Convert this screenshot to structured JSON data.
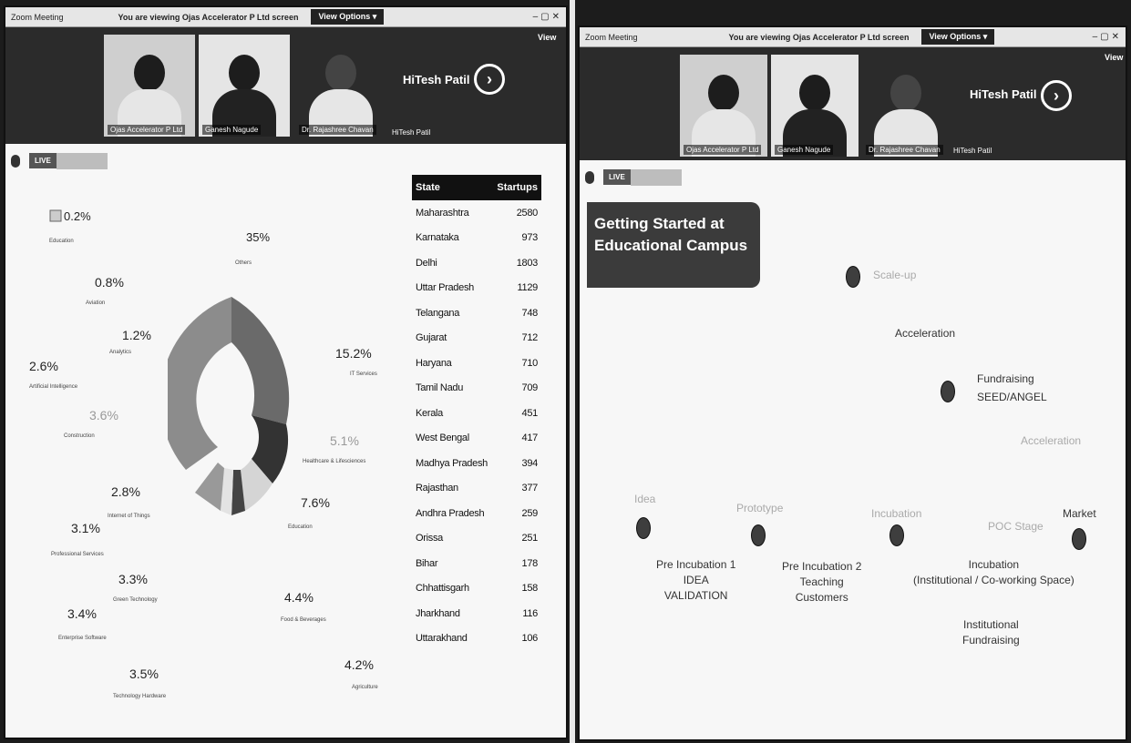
{
  "left_window": {
    "titlebar": {
      "title": "Zoom Meeting",
      "viewing": "You are viewing Ojas Accelerator P Ltd screen",
      "view_options": "View Options ▾"
    },
    "view_button": "View",
    "participants": [
      {
        "name": "Ojas Accelerator P Ltd"
      },
      {
        "name": "Ganesh Nagude"
      },
      {
        "name": "Dr. Rajashree Chavan"
      },
      {
        "name": "HiTesh Patil"
      }
    ],
    "featured_name": "HiTesh Patil",
    "next_icon": "chevron-right-circle-icon",
    "live_label": "LIVE",
    "chart": {
      "labels": [
        {
          "pct": "0.2%",
          "sector": "Education"
        },
        {
          "pct": "35%",
          "sector": "Others"
        },
        {
          "pct": "0.8%",
          "sector": "Aviation"
        },
        {
          "pct": "1.2%",
          "sector": "Analytics"
        },
        {
          "pct": "2.6%",
          "sector": "Artificial Intelligence"
        },
        {
          "pct": "3.6%",
          "sector": "Construction"
        },
        {
          "pct": "2.8%",
          "sector": "Internet of Things"
        },
        {
          "pct": "3.1%",
          "sector": "Professional Services"
        },
        {
          "pct": "3.3%",
          "sector": "Green Technology"
        },
        {
          "pct": "3.4%",
          "sector": "Enterprise Software"
        },
        {
          "pct": "3.5%",
          "sector": "Technology Hardware"
        },
        {
          "pct": "15.2%",
          "sector": "IT Services"
        },
        {
          "pct": "5.1%",
          "sector": "Healthcare & Lifesciences"
        },
        {
          "pct": "7.6%",
          "sector": "Education"
        },
        {
          "pct": "4.4%",
          "sector": "Food & Beverages"
        },
        {
          "pct": "4.2%",
          "sector": "Agriculture"
        }
      ]
    },
    "table": {
      "headers": [
        "State",
        "Startups"
      ],
      "rows": [
        [
          "Maharashtra",
          "2580"
        ],
        [
          "Karnataka",
          "973"
        ],
        [
          "Delhi",
          "1803"
        ],
        [
          "Uttar Pradesh",
          "1129"
        ],
        [
          "Telangana",
          "748"
        ],
        [
          "Gujarat",
          "712"
        ],
        [
          "Haryana",
          "710"
        ],
        [
          "Tamil Nadu",
          "709"
        ],
        [
          "Kerala",
          "451"
        ],
        [
          "West Bengal",
          "417"
        ],
        [
          "Madhya Pradesh",
          "394"
        ],
        [
          "Rajasthan",
          "377"
        ],
        [
          "Andhra Pradesh",
          "259"
        ],
        [
          "Orissa",
          "251"
        ],
        [
          "Bihar",
          "178"
        ],
        [
          "Chhattisgarh",
          "158"
        ],
        [
          "Jharkhand",
          "116"
        ],
        [
          "Uttarakhand",
          "106"
        ]
      ]
    }
  },
  "right_window": {
    "titlebar": {
      "title": "Zoom Meeting",
      "viewing": "You are viewing Ojas Accelerator P Ltd screen",
      "view_options": "View Options ▾"
    },
    "view_button": "View",
    "participants": [
      {
        "name": "Ojas Accelerator P Ltd"
      },
      {
        "name": "Ganesh Nagude"
      },
      {
        "name": "Dr. Rajashree Chavan"
      },
      {
        "name": "HiTesh Patil"
      }
    ],
    "featured_name": "HiTesh Patil",
    "live_label": "LIVE",
    "slide": {
      "title_line1": "Getting Started at",
      "title_line2": "Educational Campus",
      "top_labels": {
        "scale_up": "Scale-up",
        "acceleration_1": "Acceleration",
        "fundraising_line1": "Fundraising",
        "fundraising_line2": "SEED/ANGEL",
        "acceleration_2": "Acceleration"
      },
      "stages": [
        {
          "top": "Idea",
          "bottom_lines": [
            "Pre Incubation 1",
            "IDEA",
            "VALIDATION"
          ]
        },
        {
          "top": "Prototype",
          "bottom_lines": [
            "Pre Incubation 2",
            "Teaching",
            "Customers"
          ]
        },
        {
          "top": "Incubation",
          "bottom_lines": [
            "Incubation",
            "(Institutional / Co-working Space)"
          ]
        },
        {
          "top": "POC Stage",
          "bottom_lines": [
            "Institutional",
            "Fundraising"
          ]
        },
        {
          "top": "Market",
          "bottom_lines": []
        }
      ]
    }
  }
}
